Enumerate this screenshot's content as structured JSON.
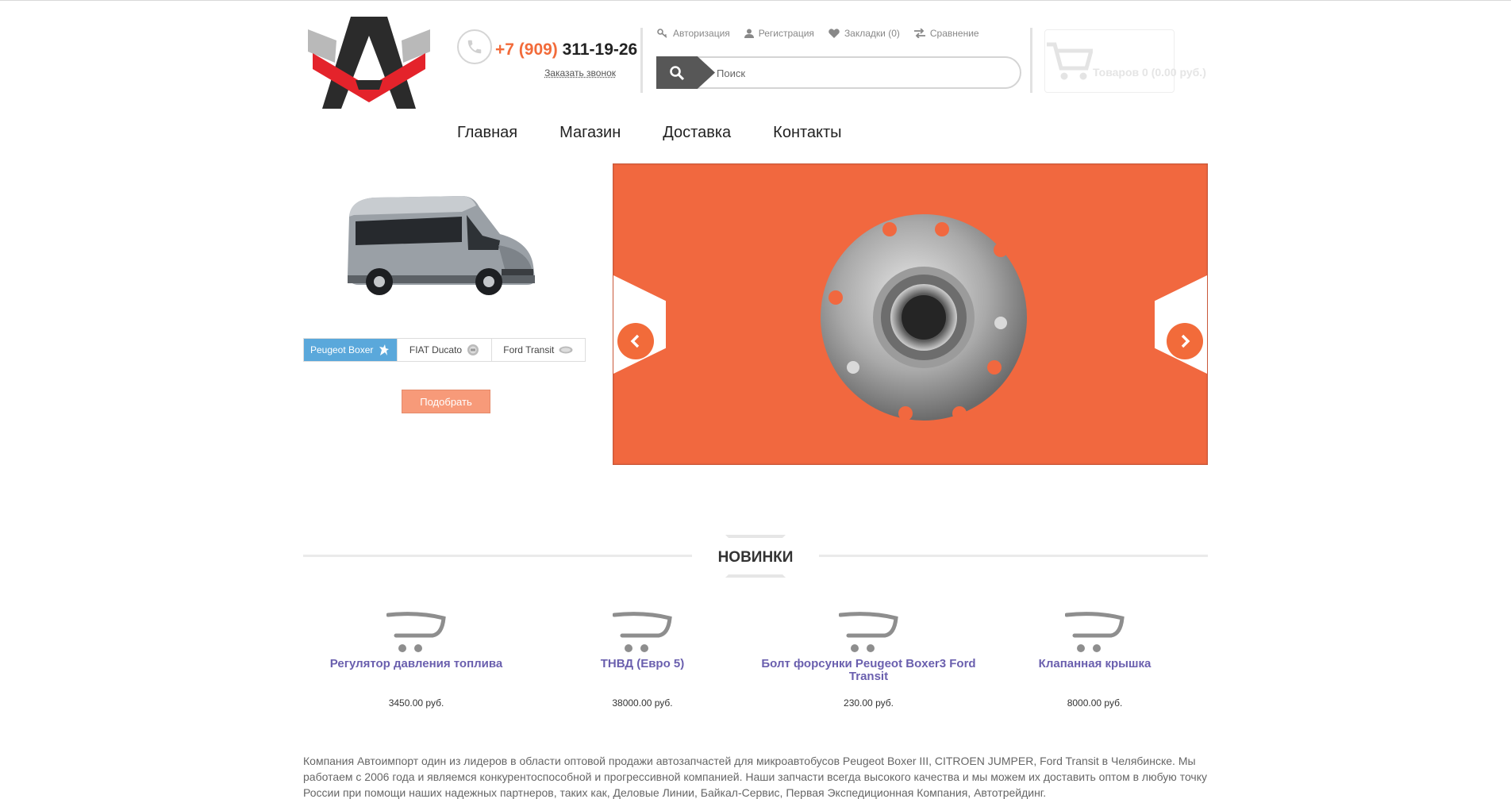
{
  "header": {
    "phone_code": "+7 (909)",
    "phone_number": "311-19-26",
    "callback_label": "Заказать звонок",
    "links": {
      "login": "Авторизация",
      "register": "Регистрация",
      "bookmarks": "Закладки (0)",
      "compare": "Сравнение"
    },
    "search_placeholder": "Поиск",
    "cart_text": "Товаров 0 (0.00 руб.)"
  },
  "nav": [
    "Главная",
    "Магазин",
    "Доставка",
    "Контакты"
  ],
  "brands": {
    "active_index": 0,
    "items": [
      "Peugeot Boxer",
      "FIAT Ducato",
      "Ford Transit"
    ]
  },
  "pick_button": "Подобрать",
  "colors": {
    "accent": "#f26b3a",
    "slider_bg": "#f1683f",
    "active_tab": "#5aa8db",
    "product_link": "#6a5fae"
  },
  "section_title": "НОВИНКИ",
  "products": [
    {
      "name": "Регулятор давления топлива",
      "price": "3450.00 руб."
    },
    {
      "name": "ТНВД (Евро 5)",
      "price": "38000.00 руб."
    },
    {
      "name": "Болт форсунки Peugeot Boxer3 Ford Transit",
      "price": "230.00 руб."
    },
    {
      "name": "Клапанная крышка",
      "price": "8000.00 руб."
    }
  ],
  "about": "Компания Автоимпорт один из лидеров в области оптовой продажи автозапчастей для микроавтобусов Peugeot Boxer III, CITROEN JUMPER, Ford Transit в Челябинске. Мы работаем с 2006 года и являемся конкурентоспособной и прогрессивной компанией. Наши запчасти всегда высокого качества и мы можем их доставить оптом в любую точку России при помощи наших надежных партнеров, таких как, Деловые Линии, Байкал-Сервис, Первая Экспедиционная Компания, Автотрейдинг."
}
